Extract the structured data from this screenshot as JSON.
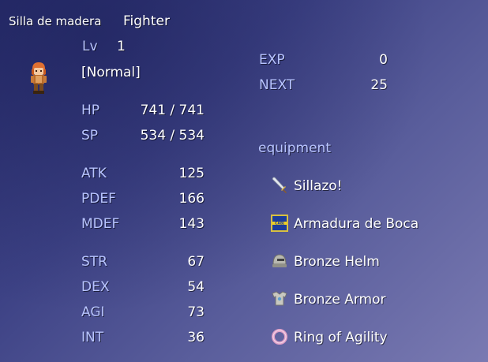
{
  "actor": {
    "name": "Silla de madera",
    "class": "Fighter",
    "level_label": "Lv",
    "level": "1",
    "state": "[Normal]",
    "sprite_icon": "fighter-sprite-icon"
  },
  "hp_sp": [
    {
      "label": "HP",
      "value": "741 / 741"
    },
    {
      "label": "SP",
      "value": "534 / 534"
    }
  ],
  "params1": [
    {
      "label": "ATK",
      "value": "125"
    },
    {
      "label": "PDEF",
      "value": "166"
    },
    {
      "label": "MDEF",
      "value": "143"
    }
  ],
  "params2": [
    {
      "label": "STR",
      "value": "67"
    },
    {
      "label": "DEX",
      "value": "54"
    },
    {
      "label": "AGI",
      "value": "73"
    },
    {
      "label": "INT",
      "value": "36"
    }
  ],
  "exp": {
    "exp_label": "EXP",
    "exp_value": "0",
    "next_label": "NEXT",
    "next_value": "25"
  },
  "equipment": {
    "label": "equipment",
    "items": [
      {
        "name": "Sillazo!",
        "icon": "sword-icon"
      },
      {
        "name": "Armadura de Boca",
        "icon": "shield-emblem-icon"
      },
      {
        "name": "Bronze Helm",
        "icon": "helmet-icon"
      },
      {
        "name": "Bronze Armor",
        "icon": "armor-icon"
      },
      {
        "name": "Ring of Agility",
        "icon": "ring-icon"
      }
    ]
  },
  "colors": {
    "system_text": "#b8c4ff",
    "normal_text": "#ffffff",
    "window_dark": "#2a2f6e",
    "window_light": "#7a7ab2"
  }
}
